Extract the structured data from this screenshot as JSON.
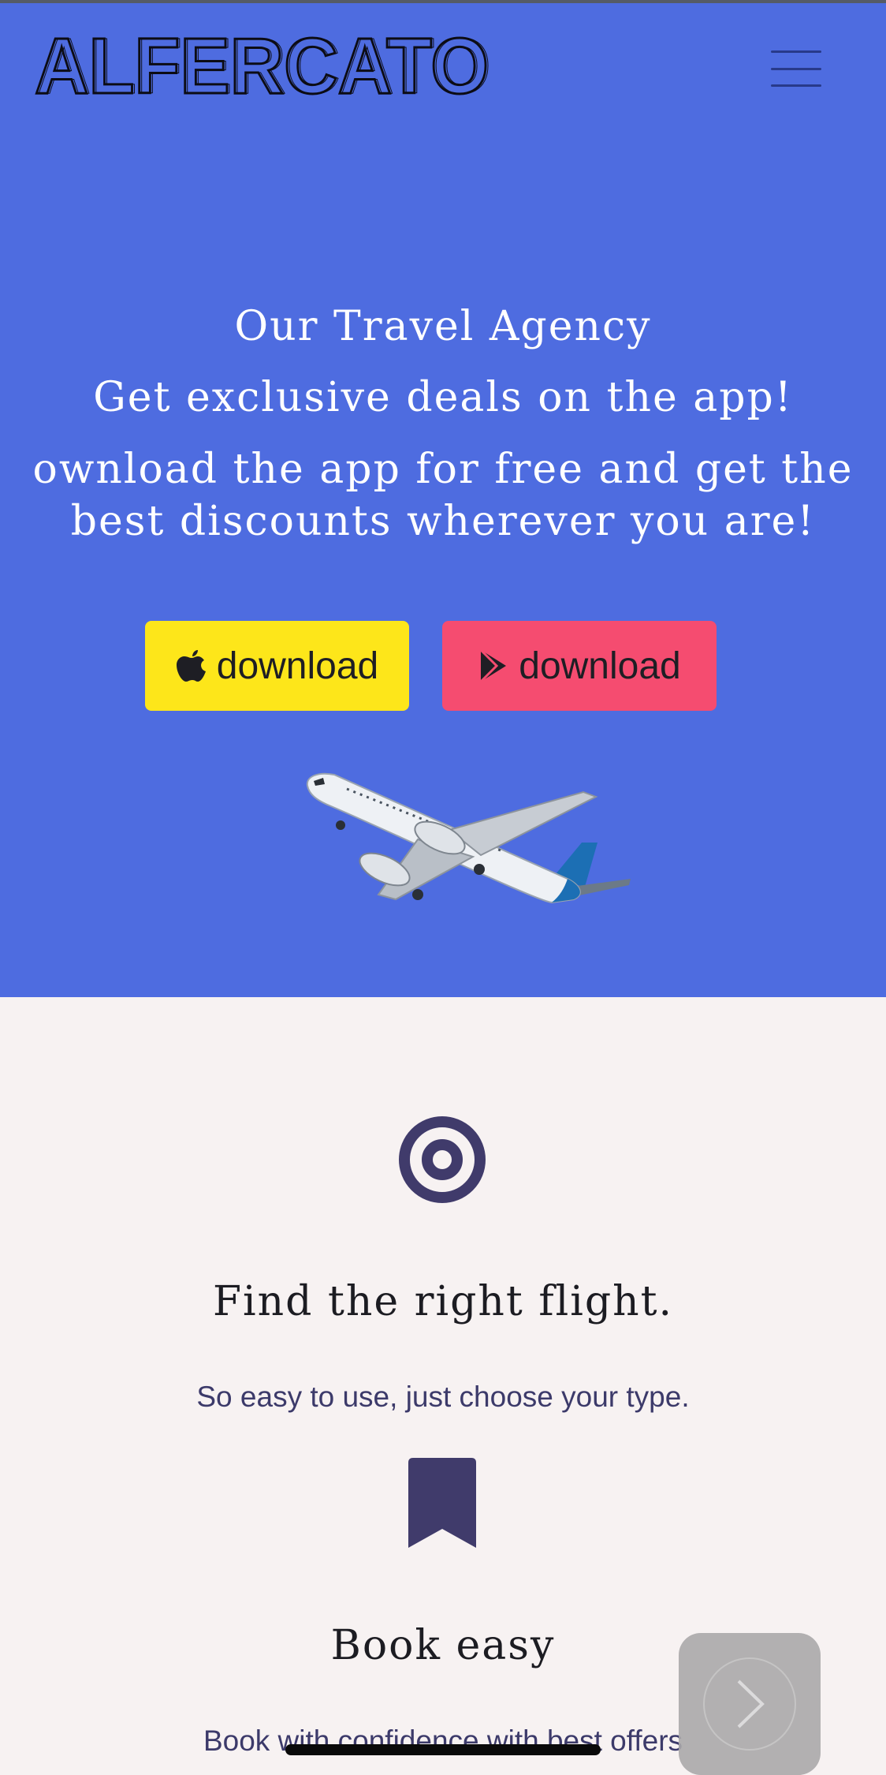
{
  "header": {
    "logo_text": "ALFERCATO",
    "menu_icon": "hamburger-menu-icon"
  },
  "hero": {
    "title": "Our Travel Agency",
    "subtitle": "Get exclusive deals on the app!",
    "description": "ownload the app for free and get the best discounts wherever you are!",
    "ios_button_label": "download",
    "android_button_label": "download",
    "ios_icon": "apple-icon",
    "android_icon": "play-store-icon",
    "image": "airplane-image"
  },
  "features": [
    {
      "icon": "target-icon",
      "title": "Find the right flight.",
      "text": "So easy to use, just choose your type."
    },
    {
      "icon": "bookmark-icon",
      "title": "Book easy",
      "text": "Book with confidence with best offers"
    }
  ],
  "floating": {
    "next_icon": "chevron-right-icon"
  },
  "colors": {
    "hero_bg": "#4e6ce0",
    "page_bg": "#f7f2f2",
    "ios_button": "#fde61a",
    "android_button": "#f54c70",
    "feature_icon": "#403b6b"
  }
}
